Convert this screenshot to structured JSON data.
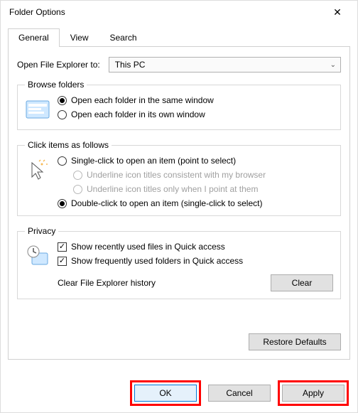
{
  "titlebar": {
    "title": "Folder Options"
  },
  "tabs": {
    "general": "General",
    "view": "View",
    "search": "Search"
  },
  "open_to": {
    "label": "Open File Explorer to:",
    "value": "This PC"
  },
  "browse": {
    "legend": "Browse folders",
    "same": "Open each folder in the same window",
    "own": "Open each folder in its own window"
  },
  "click": {
    "legend": "Click items as follows",
    "single": "Single-click to open an item (point to select)",
    "u1": "Underline icon titles consistent with my browser",
    "u2": "Underline icon titles only when I point at them",
    "double": "Double-click to open an item (single-click to select)"
  },
  "privacy": {
    "legend": "Privacy",
    "recent": "Show recently used files in Quick access",
    "freq": "Show frequently used folders in Quick access",
    "clear_label": "Clear File Explorer history",
    "clear_btn": "Clear"
  },
  "restore": "Restore Defaults",
  "footer": {
    "ok": "OK",
    "cancel": "Cancel",
    "apply": "Apply"
  }
}
